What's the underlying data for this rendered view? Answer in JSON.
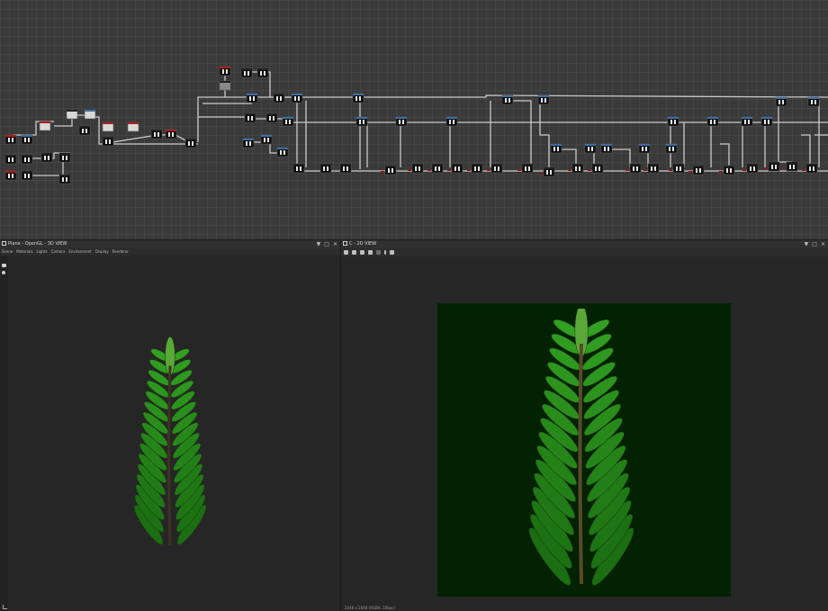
{
  "graph": {
    "name": "node-graph",
    "background": "#3a3a3a",
    "wire_color": "#c9c9c9"
  },
  "panel_3d": {
    "title": "Plane - OpenGL - 3D VIEW",
    "menu": [
      "Scene",
      "Materials",
      "Lights",
      "Camera",
      "Environment",
      "Display",
      "Renderer"
    ],
    "sidebar_icons": [
      "camera-icon",
      "light-icon"
    ]
  },
  "panel_2d": {
    "title": "C - 2D VIEW",
    "toolbar_icons": [
      "fit-icon",
      "save-icon",
      "copy-icon",
      "transform-icon",
      "crop-icon",
      "info-icon",
      "histogram-icon"
    ],
    "status": "2048 x 2048 (RGBA, 16bpc)",
    "texture_background": "#022202"
  },
  "header_icons": [
    "pin-icon",
    "maximize-icon",
    "close-icon"
  ],
  "colors": {
    "leaf_dark": "#2e5a1e",
    "leaf_light": "#4fa030",
    "stem": "#5a4a2a",
    "node_red": "#b01c1c",
    "node_blue": "#3d6fa3"
  }
}
